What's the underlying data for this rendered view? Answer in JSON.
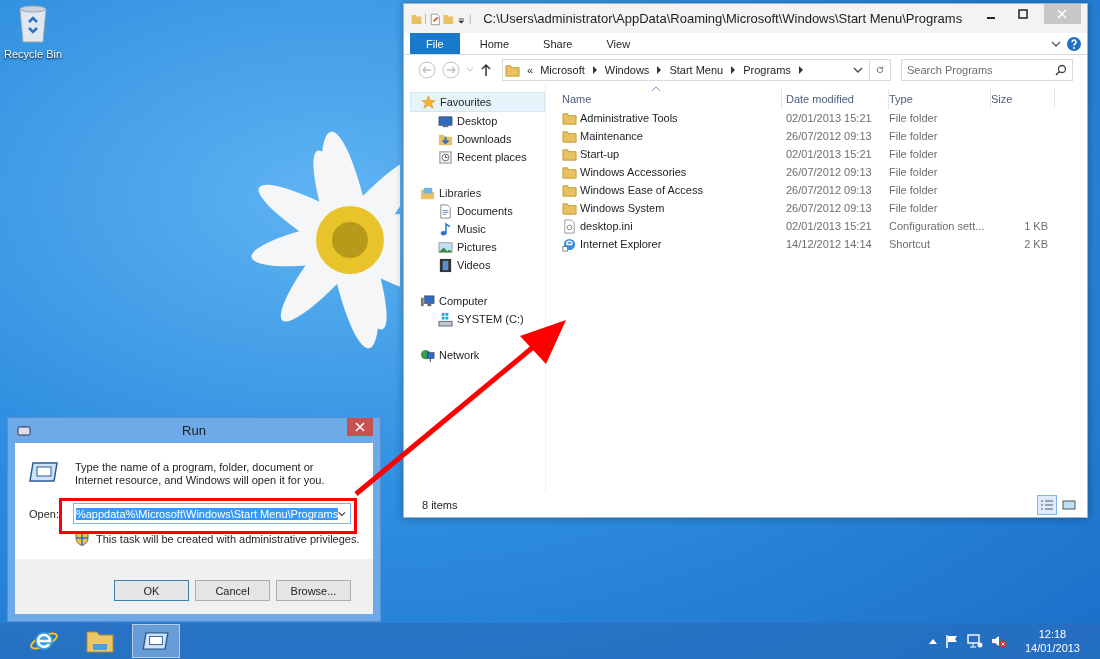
{
  "desktop": {
    "icons": [
      {
        "label": "Recycle Bin",
        "kind": "recycle"
      }
    ]
  },
  "explorer": {
    "title": "C:\\Users\\administrator\\AppData\\Roaming\\Microsoft\\Windows\\Start Menu\\Programs",
    "ribbon_tabs": [
      {
        "label": "File",
        "selected": true
      },
      {
        "label": "Home",
        "selected": false
      },
      {
        "label": "Share",
        "selected": false
      },
      {
        "label": "View",
        "selected": false
      }
    ],
    "breadcrumb": {
      "overflow": "«",
      "items": [
        "Microsoft",
        "Windows",
        "Start Menu",
        "Programs"
      ]
    },
    "search": {
      "placeholder": "Search Programs"
    },
    "nav": [
      {
        "label": "Favourites",
        "kind": "star",
        "selected": true,
        "children": [
          {
            "label": "Desktop",
            "kind": "desktop",
            "selected": false
          },
          {
            "label": "Downloads",
            "kind": "downloads",
            "selected": false
          },
          {
            "label": "Recent places",
            "kind": "recent",
            "selected": false
          }
        ]
      },
      {
        "label": "Libraries",
        "kind": "libraries",
        "selected": false,
        "children": [
          {
            "label": "Documents",
            "kind": "documents",
            "selected": false
          },
          {
            "label": "Music",
            "kind": "music",
            "selected": false
          },
          {
            "label": "Pictures",
            "kind": "pictures",
            "selected": false
          },
          {
            "label": "Videos",
            "kind": "videos",
            "selected": false
          }
        ]
      },
      {
        "label": "Computer",
        "kind": "computer",
        "selected": false,
        "children": [
          {
            "label": "SYSTEM (C:)",
            "kind": "drive",
            "selected": false
          }
        ]
      },
      {
        "label": "Network",
        "kind": "network",
        "selected": false
      }
    ],
    "columns": [
      "Name",
      "Date modified",
      "Type",
      "Size"
    ],
    "rows": [
      {
        "kind": "folder",
        "name": "Administrative Tools",
        "date": "02/01/2013 15:21",
        "type": "File folder"
      },
      {
        "kind": "folder",
        "name": "Maintenance",
        "date": "26/07/2012 09:13",
        "type": "File folder"
      },
      {
        "kind": "folder",
        "name": "Start-up",
        "date": "02/01/2013 15:21",
        "type": "File folder"
      },
      {
        "kind": "folder",
        "name": "Windows Accessories",
        "date": "26/07/2012 09:13",
        "type": "File folder"
      },
      {
        "kind": "folder",
        "name": "Windows Ease of Access",
        "date": "26/07/2012 09:13",
        "type": "File folder"
      },
      {
        "kind": "folder",
        "name": "Windows System",
        "date": "26/07/2012 09:13",
        "type": "File folder"
      },
      {
        "kind": "settings",
        "name": "desktop.ini",
        "date": "02/01/2013 15:21",
        "type": "Configuration sett...",
        "size": "1 KB"
      },
      {
        "kind": "shortcut",
        "name": "Internet Explorer",
        "date": "14/12/2012 14:14",
        "type": "Shortcut",
        "size": "2 KB"
      }
    ],
    "status": "8 items",
    "views": [
      {
        "kind": "details",
        "selected": true
      },
      {
        "kind": "tiles",
        "selected": false
      }
    ]
  },
  "run": {
    "title": "Run",
    "description": "Type the name of a program, folder, document or Internet resource, and Windows will open it for you.",
    "open_label": "Open:",
    "open_value": "%appdata%\\Microsoft\\Windows\\Start Menu\\Programs",
    "value_selected": true,
    "notice": "This task will be created with administrative privileges.",
    "buttons": [
      "OK",
      "Cancel",
      "Browse..."
    ]
  },
  "taskbar": {
    "apps": [
      {
        "kind": "browser",
        "selected": false
      },
      {
        "kind": "explorer",
        "selected": false
      },
      {
        "kind": "run",
        "selected": true
      }
    ],
    "clock": {
      "time": "12:18",
      "date": "14/01/2013"
    }
  }
}
